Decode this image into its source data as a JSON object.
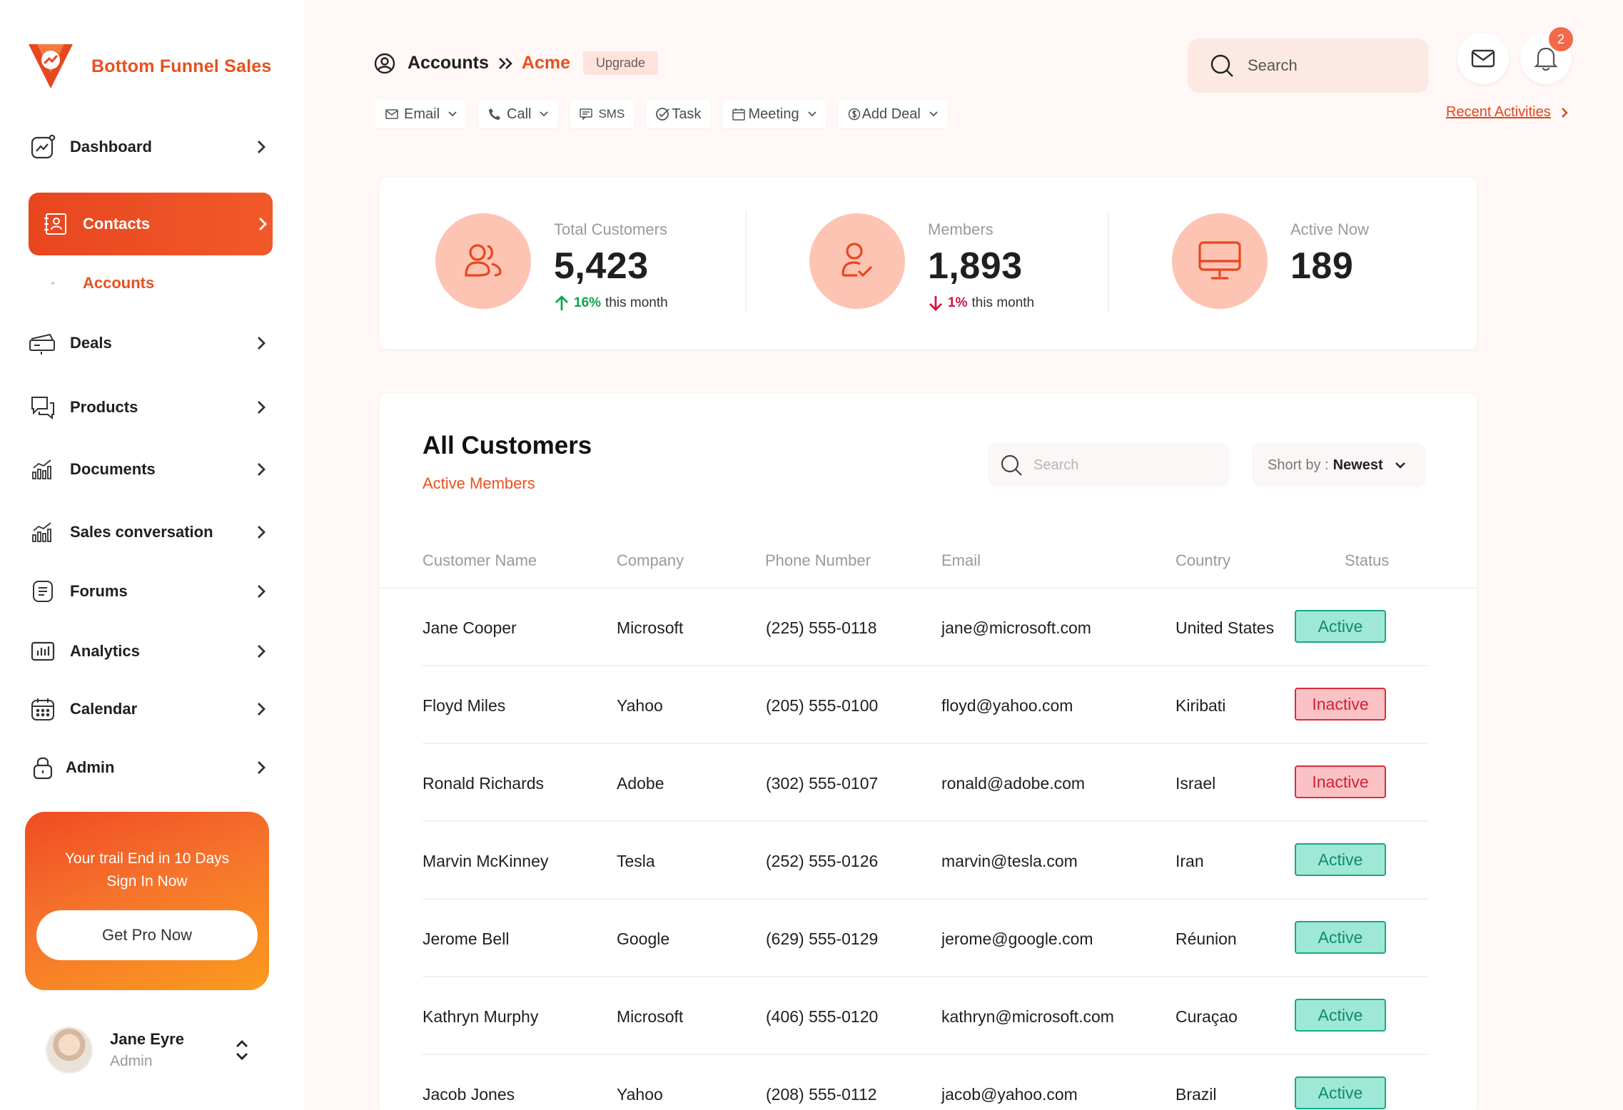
{
  "brand": {
    "name": "Bottom Funnel Sales"
  },
  "sidebar": {
    "items": [
      {
        "label": "Dashboard",
        "icon": "dashboard-icon"
      },
      {
        "label": "Contacts",
        "icon": "contacts-icon"
      },
      {
        "label": "Deals",
        "icon": "deals-icon"
      },
      {
        "label": "Products",
        "icon": "products-icon"
      },
      {
        "label": "Documents",
        "icon": "documents-icon"
      },
      {
        "label": "Sales conversation",
        "icon": "sales-conversation-icon"
      },
      {
        "label": "Forums",
        "icon": "forums-icon"
      },
      {
        "label": "Analytics",
        "icon": "analytics-icon"
      },
      {
        "label": "Calendar",
        "icon": "calendar-icon"
      },
      {
        "label": "Admin",
        "icon": "lock-icon"
      }
    ],
    "sub_item": "Accounts",
    "promo": {
      "line1": "Your trail End in 10 Days",
      "line2": "Sign In Now",
      "button": "Get Pro Now"
    },
    "user": {
      "name": "Jane Eyre",
      "role": "Admin"
    }
  },
  "header": {
    "breadcrumb": {
      "parent": "Accounts",
      "current": "Acme"
    },
    "upgrade_label": "Upgrade",
    "actions": {
      "email": "Email",
      "call": "Call",
      "sms": "SMS",
      "task": "Task",
      "meeting": "Meeting",
      "add_deal": "Add Deal"
    },
    "search_placeholder": "Search",
    "notification_count": "2",
    "recent_activities": "Recent Activities"
  },
  "stats": [
    {
      "label": "Total Customers",
      "value": "5,423",
      "delta": "16%",
      "delta_text": "this month",
      "trend": "up"
    },
    {
      "label": "Members",
      "value": "1,893",
      "delta": "1%",
      "delta_text": "this month",
      "trend": "down"
    },
    {
      "label": "Active Now",
      "value": "189"
    }
  ],
  "customers": {
    "title": "All Customers",
    "subtitle": "Active Members",
    "search_placeholder": "Search",
    "sort_prefix": "Short by :",
    "sort_value": "Newest",
    "columns": [
      "Customer Name",
      "Company",
      "Phone Number",
      "Email",
      "Country",
      "Status"
    ],
    "rows": [
      {
        "name": "Jane Cooper",
        "company": "Microsoft",
        "phone": "(225) 555-0118",
        "email": "jane@microsoft.com",
        "country": "United States",
        "status": "Active"
      },
      {
        "name": "Floyd Miles",
        "company": "Yahoo",
        "phone": "(205) 555-0100",
        "email": "floyd@yahoo.com",
        "country": "Kiribati",
        "status": "Inactive"
      },
      {
        "name": "Ronald Richards",
        "company": "Adobe",
        "phone": "(302) 555-0107",
        "email": "ronald@adobe.com",
        "country": "Israel",
        "status": "Inactive"
      },
      {
        "name": "Marvin McKinney",
        "company": "Tesla",
        "phone": "(252) 555-0126",
        "email": "marvin@tesla.com",
        "country": "Iran",
        "status": "Active"
      },
      {
        "name": "Jerome Bell",
        "company": "Google",
        "phone": "(629) 555-0129",
        "email": "jerome@google.com",
        "country": "Réunion",
        "status": "Active"
      },
      {
        "name": "Kathryn Murphy",
        "company": "Microsoft",
        "phone": "(406) 555-0120",
        "email": "kathryn@microsoft.com",
        "country": "Curaçao",
        "status": "Active"
      },
      {
        "name": "Jacob Jones",
        "company": "Yahoo",
        "phone": "(208) 555-0112",
        "email": "jacob@yahoo.com",
        "country": "Brazil",
        "status": "Active"
      }
    ]
  },
  "colors": {
    "accent": "#e8501f",
    "active_bg": "#9fe8d5",
    "inactive_bg": "#fbc2c5",
    "page_bg": "#fff8f6"
  }
}
